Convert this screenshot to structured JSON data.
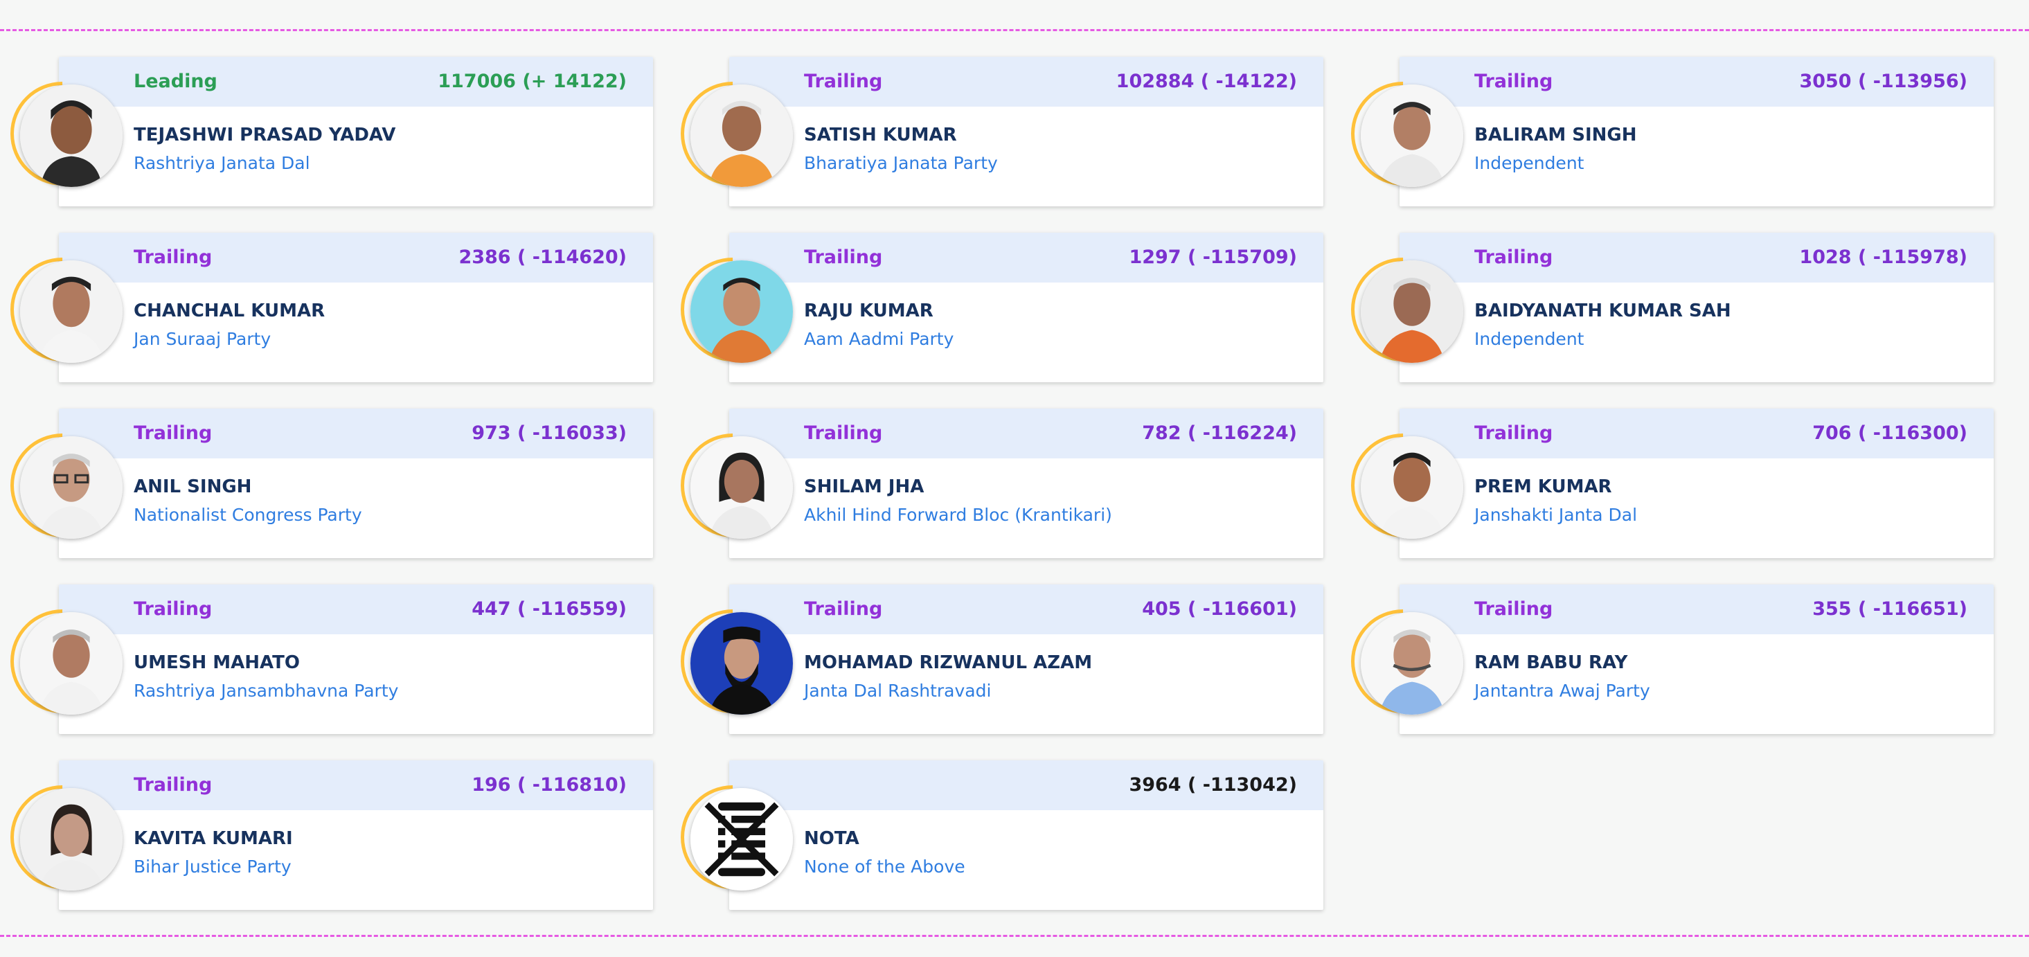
{
  "colors": {
    "leading": "#2b9e55",
    "trailing": "#9231d8",
    "votes_trailing": "#7b31cf",
    "name": "#17325e",
    "party": "#2f7de0",
    "card_band": "#e4edfb",
    "divider": "#e65ae3",
    "avatar_ring": "#ffc13a"
  },
  "candidates": [
    {
      "status": "Leading",
      "votes": "117006 (+ 14122)",
      "name": "TEJASHWI PRASAD YADAV",
      "party": "Rashtriya Janata Dal",
      "avatar_icon": "candidate-photo"
    },
    {
      "status": "Trailing",
      "votes": "102884 ( -14122)",
      "name": "SATISH KUMAR",
      "party": "Bharatiya Janata Party",
      "avatar_icon": "candidate-photo"
    },
    {
      "status": "Trailing",
      "votes": "3050 ( -113956)",
      "name": "BALIRAM SINGH",
      "party": "Independent",
      "avatar_icon": "candidate-photo"
    },
    {
      "status": "Trailing",
      "votes": "2386 ( -114620)",
      "name": "CHANCHAL KUMAR",
      "party": "Jan Suraaj Party",
      "avatar_icon": "candidate-photo"
    },
    {
      "status": "Trailing",
      "votes": "1297 ( -115709)",
      "name": "RAJU KUMAR",
      "party": "Aam Aadmi Party",
      "avatar_icon": "candidate-photo"
    },
    {
      "status": "Trailing",
      "votes": "1028 ( -115978)",
      "name": "BAIDYANATH KUMAR SAH",
      "party": "Independent",
      "avatar_icon": "candidate-photo"
    },
    {
      "status": "Trailing",
      "votes": "973 ( -116033)",
      "name": "ANIL SINGH",
      "party": "Nationalist Congress Party",
      "avatar_icon": "candidate-photo"
    },
    {
      "status": "Trailing",
      "votes": "782 ( -116224)",
      "name": "SHILAM JHA",
      "party": "Akhil Hind Forward Bloc (Krantikari)",
      "avatar_icon": "candidate-photo"
    },
    {
      "status": "Trailing",
      "votes": "706 ( -116300)",
      "name": "PREM KUMAR",
      "party": "Janshakti Janta Dal",
      "avatar_icon": "candidate-photo"
    },
    {
      "status": "Trailing",
      "votes": "447 ( -116559)",
      "name": "UMESH MAHATO",
      "party": "Rashtriya Jansambhavna Party",
      "avatar_icon": "candidate-photo"
    },
    {
      "status": "Trailing",
      "votes": "405 ( -116601)",
      "name": "MOHAMAD RIZWANUL AZAM",
      "party": "Janta Dal Rashtravadi",
      "avatar_icon": "candidate-photo"
    },
    {
      "status": "Trailing",
      "votes": "355 ( -116651)",
      "name": "RAM BABU RAY",
      "party": "Jantantra Awaj Party",
      "avatar_icon": "candidate-photo"
    },
    {
      "status": "Trailing",
      "votes": "196 ( -116810)",
      "name": "KAVITA KUMARI",
      "party": "Bihar Justice Party",
      "avatar_icon": "candidate-photo"
    },
    {
      "status": "",
      "votes": "3964 ( -113042)",
      "name": "NOTA",
      "party": "None of the Above",
      "avatar_icon": "nota-icon"
    }
  ]
}
